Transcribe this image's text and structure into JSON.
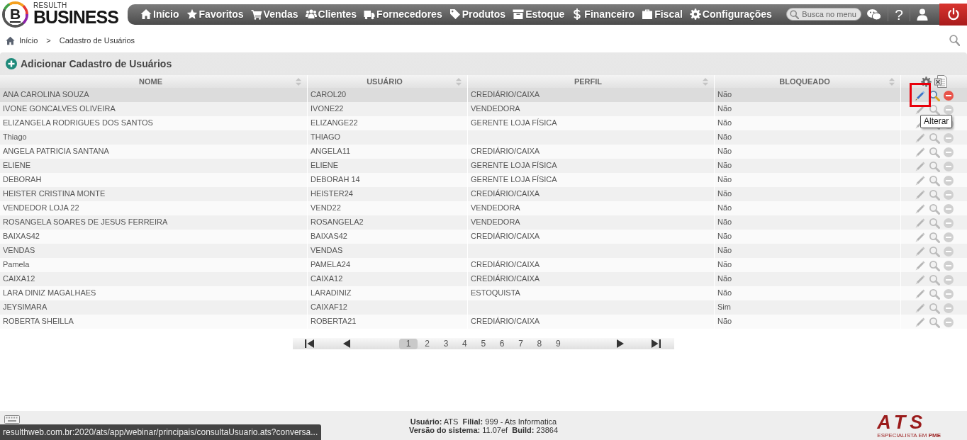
{
  "header": {
    "logo_letter": "B",
    "brand_small": "RESULTH",
    "brand": "BUSINESS",
    "menu": [
      "Início",
      "Favoritos",
      "Vendas",
      "Clientes",
      "Fornecedores",
      "Produtos",
      "Estoque",
      "Financeiro",
      "Fiscal",
      "Configurações"
    ],
    "search": {
      "placeholder": "Busca no menu"
    },
    "help_label": "?"
  },
  "breadcrumb": {
    "items": [
      "Início",
      "Cadastro de Usuários"
    ],
    "separator": ">"
  },
  "panel": {
    "title": "Adicionar Cadastro de Usuários"
  },
  "table": {
    "columns": [
      "NOME",
      "USUÁRIO",
      "PERFIL",
      "BLOQUEADO"
    ],
    "rows": [
      {
        "nome": "ANA CAROLINA SOUZA",
        "usuario": "CAROL20",
        "perfil": "CREDIÁRIO/CAIXA",
        "bloqueado": "Não",
        "highlighted": true,
        "edit_marked": true,
        "tooltip": "Alterar"
      },
      {
        "nome": "IVONE GONCALVES OLIVEIRA",
        "usuario": "IVONE22",
        "perfil": "VENDEDORA",
        "bloqueado": "Não",
        "highlighted": false,
        "edit_marked": false
      },
      {
        "nome": "ELIZANGELA RODRIGUES DOS SANTOS",
        "usuario": "ELIZANGE22",
        "perfil": "GERENTE LOJA FÍSICA",
        "bloqueado": "Não",
        "highlighted": false,
        "edit_marked": false
      },
      {
        "nome": "Thiago",
        "usuario": "THIAGO",
        "bloqueado": "Não",
        "highlighted": false,
        "edit_marked": false
      },
      {
        "nome": "ANGELA PATRICIA SANTANA",
        "usuario": "ANGELA11",
        "perfil": "CREDIÁRIO/CAIXA",
        "bloqueado": "Não",
        "highlighted": false,
        "edit_marked": false
      },
      {
        "nome": "ELIENE",
        "usuario": "ELIENE",
        "perfil": "GERENTE LOJA FÍSICA",
        "bloqueado": "Não",
        "highlighted": false,
        "edit_marked": false
      },
      {
        "nome": "DEBORAH",
        "usuario": "DEBORAH 14",
        "perfil": "GERENTE LOJA FÍSICA",
        "bloqueado": "Não",
        "highlighted": false,
        "edit_marked": false
      },
      {
        "nome": "HEISTER CRISTINA MONTE",
        "usuario": "HEISTER24",
        "perfil": "CREDIÁRIO/CAIXA",
        "bloqueado": "Não",
        "highlighted": false,
        "edit_marked": false
      },
      {
        "nome": "VENDEDOR LOJA 22",
        "usuario": "VEND22",
        "perfil": "VENDEDORA",
        "bloqueado": "Não",
        "highlighted": false,
        "edit_marked": false
      },
      {
        "nome": "ROSANGELA SOARES DE JESUS FERREIRA",
        "usuario": "ROSANGELA2",
        "perfil": "VENDEDORA",
        "bloqueado": "Não",
        "highlighted": false,
        "edit_marked": false
      },
      {
        "nome": "BAIXAS42",
        "usuario": "BAIXAS42",
        "perfil": "CREDIÁRIO/CAIXA",
        "bloqueado": "Não",
        "highlighted": false,
        "edit_marked": false
      },
      {
        "nome": "VENDAS",
        "usuario": "VENDAS",
        "bloqueado": "Não",
        "highlighted": false,
        "edit_marked": false
      },
      {
        "nome": "Pamela",
        "usuario": "PAMELA24",
        "perfil": "CREDIÁRIO/CAIXA",
        "bloqueado": "Não",
        "highlighted": false,
        "edit_marked": false
      },
      {
        "nome": "CAIXA12",
        "usuario": "CAIXA12",
        "perfil": "CREDIÁRIO/CAIXA",
        "bloqueado": "Não",
        "highlighted": false,
        "edit_marked": false
      },
      {
        "nome": "LARA DINIZ MAGALHAES",
        "usuario": "LARADINIZ",
        "perfil": "ESTOQUISTA",
        "bloqueado": "Não",
        "highlighted": false,
        "edit_marked": false
      },
      {
        "nome": "JEYSIMARA",
        "usuario": "CAIXAF12",
        "bloqueado": "Sim",
        "highlighted": false,
        "edit_marked": false
      },
      {
        "nome": "ROBERTA SHEILLA",
        "usuario": "ROBERTA21",
        "perfil": "CREDIÁRIO/CAIXA",
        "bloqueado": "Não",
        "highlighted": false,
        "edit_marked": false
      }
    ]
  },
  "pagination": {
    "pages": [
      {
        "label": "1",
        "selected": true
      },
      {
        "label": "2",
        "selected": false
      },
      {
        "label": "3",
        "selected": false
      },
      {
        "label": "4",
        "selected": false
      },
      {
        "label": "5",
        "selected": false
      },
      {
        "label": "6",
        "selected": false
      },
      {
        "label": "7",
        "selected": false
      },
      {
        "label": "8",
        "selected": false
      },
      {
        "label": "9",
        "selected": false
      }
    ]
  },
  "footer": {
    "info_lines": [
      "**Usuário:** ATS  **Filial:** 999 - Ats Informatica",
      "**Versão do sistema:** 11.07ef  **Build:** 23864"
    ],
    "logo": "ATS",
    "tagline": "ESPECIALISTA EM **PME**"
  },
  "status_url": "resulthweb.com.br:2020/ats/app/webinar/principais/consultaUsuario.ats?conversa..."
}
